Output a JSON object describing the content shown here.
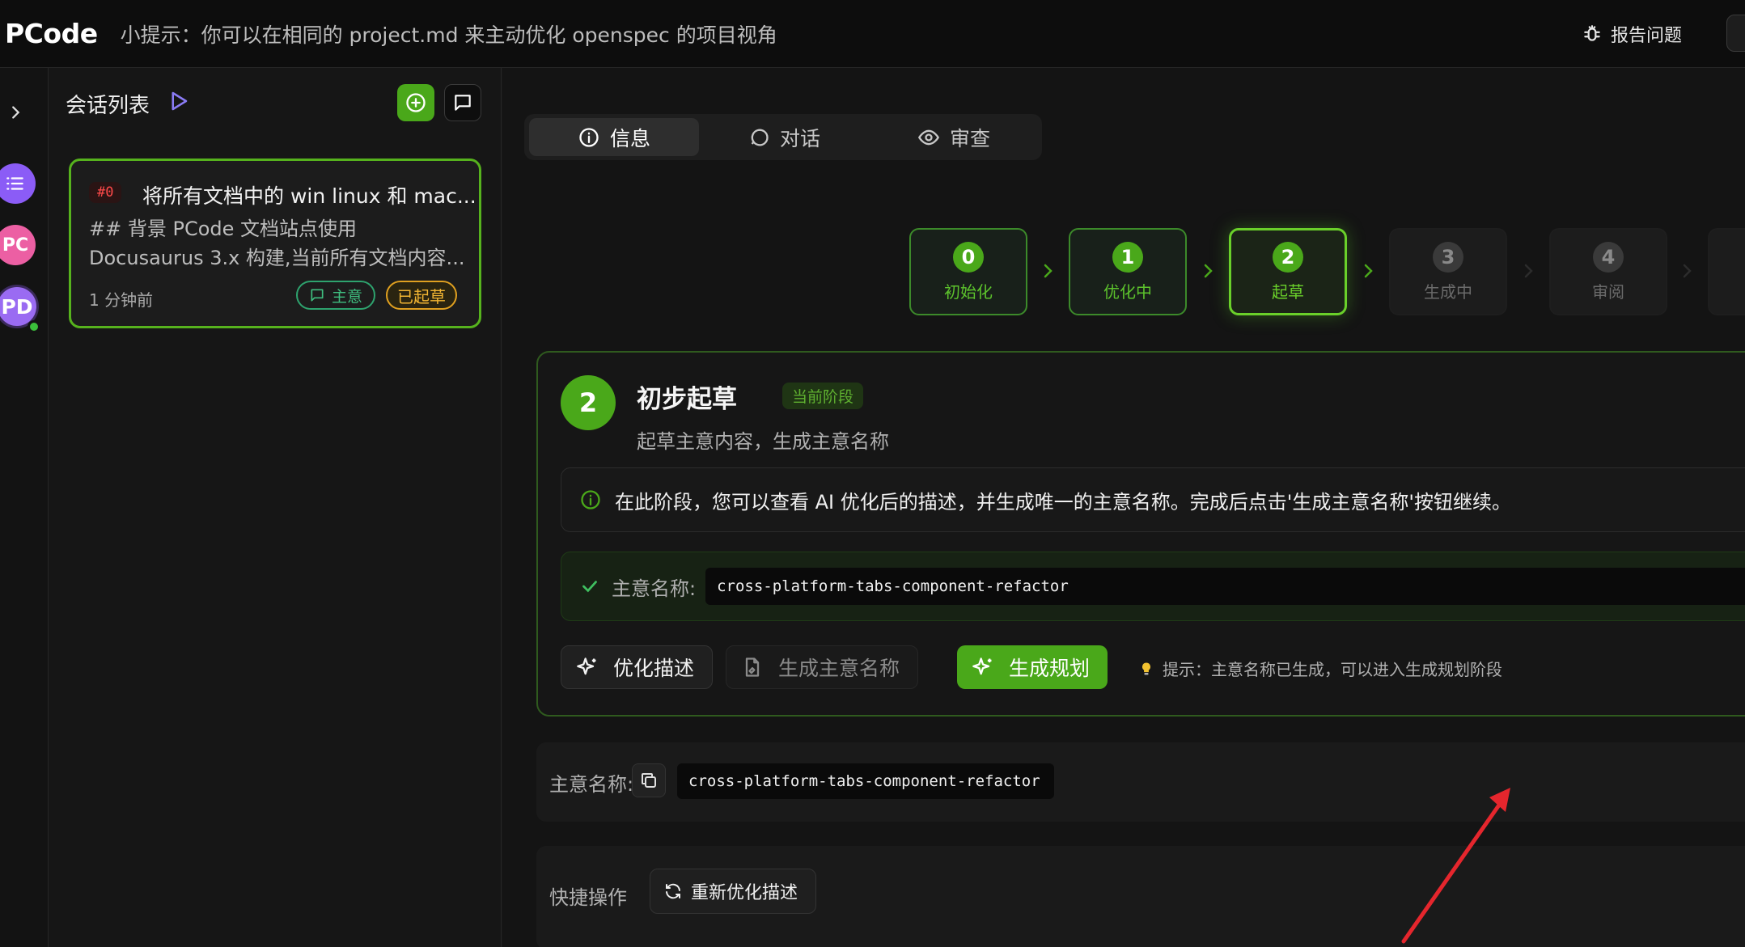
{
  "header": {
    "brand": "PCode",
    "tip": "小提示：你可以在相同的 project.md 来主动优化 openspec 的项目视角",
    "report_label": "报告问题"
  },
  "rail": {
    "avatars": [
      "PC",
      "PD"
    ]
  },
  "sessions": {
    "title": "会话列表",
    "card": {
      "tag": "#0",
      "title": "将所有文档中的 win linux 和 mac...",
      "line1": "## 背景 PCode 文档站点使用",
      "line2": "Docusaurus 3.x 构建,当前所有文档内容...",
      "time": "1 分钟前",
      "badge_topic": "主意",
      "badge_status": "已起草"
    }
  },
  "tabs": [
    {
      "label": "信息"
    },
    {
      "label": "对话"
    },
    {
      "label": "审查"
    }
  ],
  "stepper": [
    {
      "num": "0",
      "label": "初始化",
      "state": "done"
    },
    {
      "num": "1",
      "label": "优化中",
      "state": "done"
    },
    {
      "num": "2",
      "label": "起草",
      "state": "active"
    },
    {
      "num": "3",
      "label": "生成中",
      "state": "todo"
    },
    {
      "num": "4",
      "label": "审阅",
      "state": "todo"
    }
  ],
  "stage": {
    "num": "2",
    "title": "初步起草",
    "badge": "当前阶段",
    "subtitle": "起草主意内容，生成主意名称",
    "notice": "在此阶段，您可以查看 AI 优化后的描述，并生成唯一的主意名称。完成后点击'生成主意名称'按钮继续。",
    "name_label": "主意名称:",
    "name_value": "cross-platform-tabs-component-refactor",
    "btn_optimize": "优化描述",
    "btn_gen_name": "生成主意名称",
    "btn_plan": "生成规划",
    "hint": "提示：主意名称已生成，可以进入生成规划阶段"
  },
  "topic": {
    "label": "主意名称:",
    "value": "cross-platform-tabs-component-refactor"
  },
  "quick": {
    "label": "快捷操作",
    "btn_reoptimize": "重新优化描述"
  },
  "colors": {
    "accent_green": "#4aa81a",
    "draft_orange": "#e0a020",
    "tag_red": "#ff4a4a",
    "avatar_purple": "#8b5cf6",
    "avatar_pink": "#ec5fa3",
    "annotation_red": "#e5262d"
  }
}
